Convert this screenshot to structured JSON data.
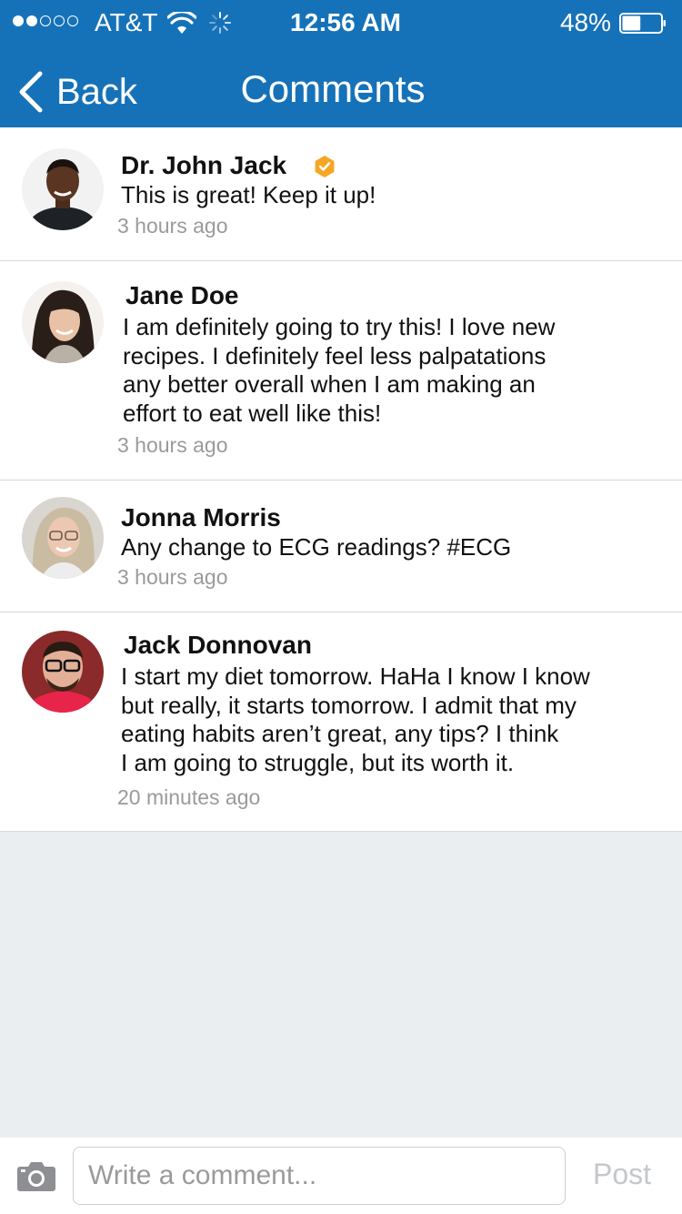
{
  "status_bar": {
    "carrier": "AT&T",
    "time": "12:56 AM",
    "battery_percent": "48%",
    "battery_level": 0.48,
    "signal_bars_filled": 2,
    "signal_bars_total": 5
  },
  "nav": {
    "back_label": "Back",
    "title": "Comments"
  },
  "comments": [
    {
      "name": "Dr. John Jack",
      "verified": true,
      "lines": [
        "This is great! Keep it up!"
      ],
      "time_ago": "3 hours ago"
    },
    {
      "name": "Jane Doe",
      "verified": false,
      "lines": [
        "I am definitely going to try this! I love new",
        "recipes. I definitely feel less palpatations",
        "any better overall when I am making an",
        "effort to eat well like this!"
      ],
      "time_ago": "3 hours ago"
    },
    {
      "name": "Jonna Morris",
      "verified": false,
      "lines": [
        "Any change to ECG readings? #ECG"
      ],
      "time_ago": "3 hours ago"
    },
    {
      "name": "Jack Donnovan",
      "verified": false,
      "lines": [
        "I start my diet tomorrow. HaHa I know I know",
        "but really, it starts tomorrow. I admit that my",
        "eating habits aren’t great, any tips? I think",
        "I am going to struggle, but its worth it."
      ],
      "time_ago": "20 minutes ago"
    }
  ],
  "composer": {
    "placeholder": "Write a comment...",
    "post_label": "Post"
  },
  "colors": {
    "nav_background": "#1672b8",
    "verified_badge": "#f5a623",
    "page_background": "#ebeef1"
  },
  "icons": {
    "back": "chevron-left-icon",
    "camera": "camera-icon",
    "verified": "verified-badge-icon",
    "wifi": "wifi-icon",
    "activity": "activity-spinner-icon",
    "battery": "battery-icon"
  }
}
